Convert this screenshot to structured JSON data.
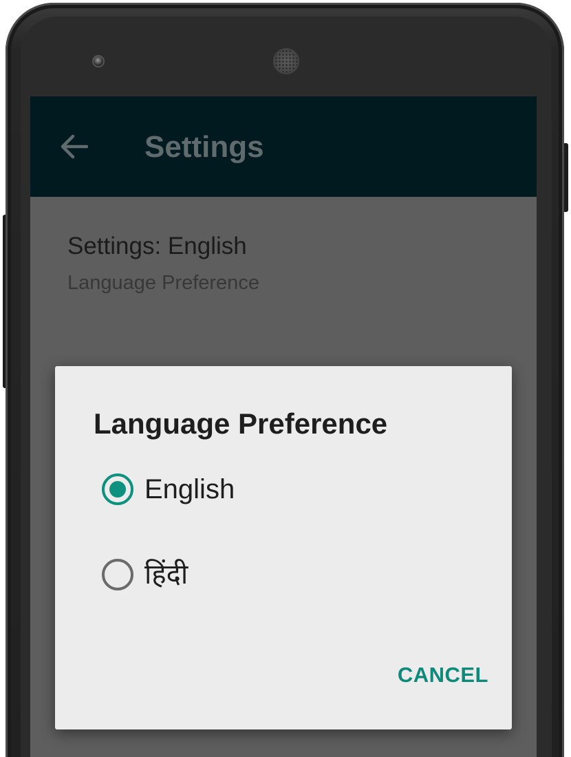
{
  "app_bar": {
    "title": "Settings",
    "background_color": "#011a1f",
    "back_icon": "arrow-back-icon"
  },
  "preference": {
    "title": "Settings: English",
    "summary": "Language Preference"
  },
  "dialog": {
    "title": "Language Preference",
    "accent_color": "#0f9180",
    "options": [
      {
        "label": "English",
        "selected": true
      },
      {
        "label": "हिंदी",
        "selected": false
      }
    ],
    "cancel_label": "CANCEL"
  }
}
